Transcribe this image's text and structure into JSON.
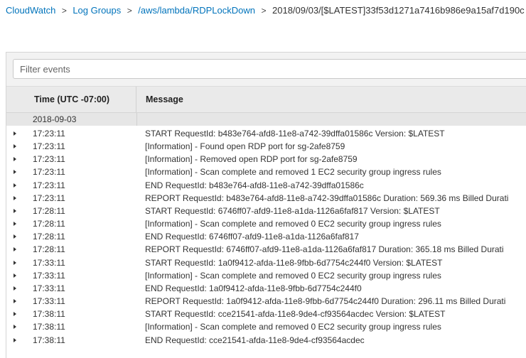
{
  "breadcrumb": {
    "items": [
      "CloudWatch",
      "Log Groups",
      "/aws/lambda/RDPLockDown"
    ],
    "current": "2018/09/03/[$LATEST]33f53d1271a7416b986e9a15af7d190c",
    "separator": ">"
  },
  "filter": {
    "placeholder": "Filter events",
    "value": ""
  },
  "table": {
    "columns": [
      "Time (UTC -07:00)",
      "Message"
    ],
    "date_group": "2018-09-03",
    "rows": [
      {
        "time": "17:23:11",
        "message": "START RequestId: b483e764-afd8-11e8-a742-39dffa01586c Version: $LATEST"
      },
      {
        "time": "17:23:11",
        "message": "[Information] - Found open RDP port for sg-2afe8759"
      },
      {
        "time": "17:23:11",
        "message": "[Information] - Removed open RDP port for sg-2afe8759"
      },
      {
        "time": "17:23:11",
        "message": "[Information] - Scan complete and removed 1 EC2 security group ingress rules"
      },
      {
        "time": "17:23:11",
        "message": "END RequestId: b483e764-afd8-11e8-a742-39dffa01586c"
      },
      {
        "time": "17:23:11",
        "message": "REPORT RequestId: b483e764-afd8-11e8-a742-39dffa01586c Duration: 569.36 ms Billed Durati"
      },
      {
        "time": "17:28:11",
        "message": "START RequestId: 6746ff07-afd9-11e8-a1da-1126a6faf817 Version: $LATEST"
      },
      {
        "time": "17:28:11",
        "message": "[Information] - Scan complete and removed 0 EC2 security group ingress rules"
      },
      {
        "time": "17:28:11",
        "message": "END RequestId: 6746ff07-afd9-11e8-a1da-1126a6faf817"
      },
      {
        "time": "17:28:11",
        "message": "REPORT RequestId: 6746ff07-afd9-11e8-a1da-1126a6faf817 Duration: 365.18 ms Billed Durati"
      },
      {
        "time": "17:33:11",
        "message": "START RequestId: 1a0f9412-afda-11e8-9fbb-6d7754c244f0 Version: $LATEST"
      },
      {
        "time": "17:33:11",
        "message": "[Information] - Scan complete and removed 0 EC2 security group ingress rules"
      },
      {
        "time": "17:33:11",
        "message": "END RequestId: 1a0f9412-afda-11e8-9fbb-6d7754c244f0"
      },
      {
        "time": "17:33:11",
        "message": "REPORT RequestId: 1a0f9412-afda-11e8-9fbb-6d7754c244f0 Duration: 296.11 ms Billed Durati"
      },
      {
        "time": "17:38:11",
        "message": "START RequestId: cce21541-afda-11e8-9de4-cf93564acdec Version: $LATEST"
      },
      {
        "time": "17:38:11",
        "message": "[Information] - Scan complete and removed 0 EC2 security group ingress rules"
      },
      {
        "time": "17:38:11",
        "message": "END RequestId: cce21541-afda-11e8-9de4-cf93564acdec"
      }
    ]
  },
  "colors": {
    "link": "#0073bb",
    "header_bg": "#eaeaea",
    "filter_bg": "#f2f2f2"
  }
}
